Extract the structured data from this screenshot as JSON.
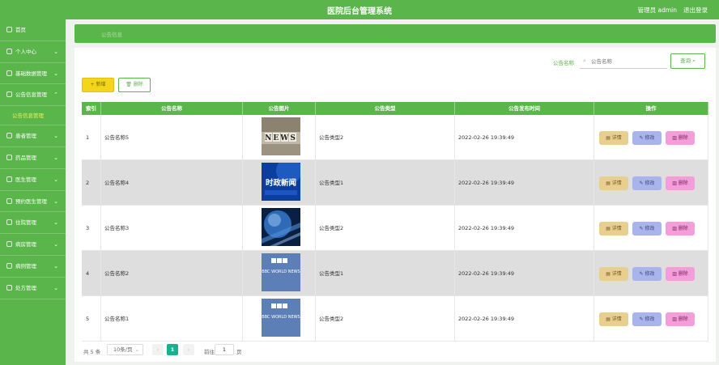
{
  "header": {
    "title": "医院后台管理系统",
    "user": "管理员 admin",
    "logout": "退出登录"
  },
  "sidebar": {
    "items": [
      {
        "label": "首页",
        "chevron": ""
      },
      {
        "label": "个人中心",
        "chevron": "⌄"
      },
      {
        "label": "基础数据管理",
        "chevron": "⌄"
      },
      {
        "label": "公告信息管理",
        "chevron": "⌃"
      },
      {
        "label": "公告信息管理"
      },
      {
        "label": "患者管理",
        "chevron": "⌄"
      },
      {
        "label": "药品管理",
        "chevron": "⌄"
      },
      {
        "label": "医生管理",
        "chevron": "⌄"
      },
      {
        "label": "预约医生管理",
        "chevron": "⌄"
      },
      {
        "label": "住院管理",
        "chevron": "⌄"
      },
      {
        "label": "病房管理",
        "chevron": "⌄"
      },
      {
        "label": "病例管理",
        "chevron": "⌄"
      },
      {
        "label": "处方管理",
        "chevron": "⌄"
      }
    ]
  },
  "breadcrumb": "公告信息",
  "search": {
    "label": "公告名称",
    "placeholder": "公告名称",
    "button": "查询"
  },
  "actions": {
    "add": "+ 新增",
    "delete": "删除"
  },
  "table": {
    "headers": [
      "索引",
      "公告名称",
      "公告图片",
      "公告类型",
      "公告发布时间",
      "操作"
    ],
    "rows": [
      {
        "index": "1",
        "name": "公告名称5",
        "image": "NEWS",
        "type": "公告类型2",
        "time": "2022-02-26 19:39:49"
      },
      {
        "index": "2",
        "name": "公告名称4",
        "image": "时政新闻",
        "type": "公告类型1",
        "time": "2022-02-26 19:39:49"
      },
      {
        "index": "3",
        "name": "公告名称3",
        "image": "",
        "type": "公告类型2",
        "time": "2022-02-26 19:39:49"
      },
      {
        "index": "4",
        "name": "公告名称2",
        "image": "BBC WORLD NEWS",
        "type": "公告类型1",
        "time": "2022-02-26 19:39:49"
      },
      {
        "index": "5",
        "name": "公告名称1",
        "image": "BBC WORLD NEWS",
        "type": "公告类型2",
        "time": "2022-02-26 19:39:49"
      }
    ],
    "ops": {
      "detail": "详情",
      "edit": "修改",
      "delete": "删除"
    }
  },
  "pagination": {
    "total": "共 5 条",
    "page_size": "10条/页",
    "current": "1",
    "goto": "前往",
    "goto_value": "1",
    "page": "页"
  },
  "colors": {
    "primary": "#5ab54a",
    "add": "#f3d51b",
    "detail": "#e8cf8f",
    "edit": "#a9b3ec",
    "delete": "#f39ed9",
    "current_page": "#1db08f"
  }
}
